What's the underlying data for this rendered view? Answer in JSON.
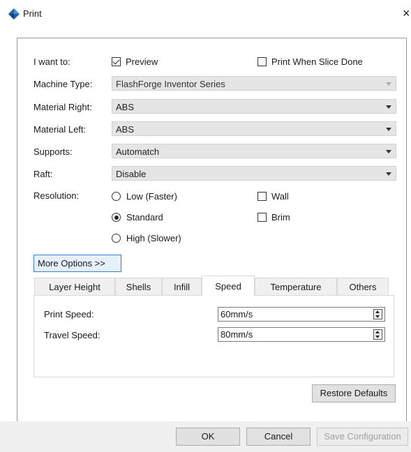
{
  "window": {
    "title": "Print",
    "close_glyph": "×"
  },
  "form": {
    "i_want_to": {
      "label": "I want to:",
      "preview": {
        "label": "Preview",
        "checked": true
      },
      "print_when_slice_done": {
        "label": "Print When Slice Done",
        "checked": false
      }
    },
    "machine_type": {
      "label": "Machine Type:",
      "value": "FlashForge Inventor Series",
      "enabled": false
    },
    "material_right": {
      "label": "Material Right:",
      "value": "ABS"
    },
    "material_left": {
      "label": "Material Left:",
      "value": "ABS"
    },
    "supports": {
      "label": "Supports:",
      "value": "Automatch"
    },
    "raft": {
      "label": "Raft:",
      "value": "Disable"
    },
    "resolution": {
      "label": "Resolution:",
      "options": [
        "Low (Faster)",
        "Standard",
        "High (Slower)"
      ],
      "selected": "Standard"
    },
    "wall": {
      "label": "Wall",
      "checked": false
    },
    "brim": {
      "label": "Brim",
      "checked": false
    }
  },
  "more_options_label": "More Options >>",
  "tabs": [
    "Layer Height",
    "Shells",
    "Infill",
    "Speed",
    "Temperature",
    "Others"
  ],
  "active_tab": "Speed",
  "speed": {
    "print_speed": {
      "label": "Print Speed:",
      "value": "60mm/s"
    },
    "travel_speed": {
      "label": "Travel Speed:",
      "value": "80mm/s"
    }
  },
  "buttons": {
    "restore_defaults": "Restore Defaults",
    "ok": "OK",
    "cancel": "Cancel",
    "save_configuration": "Save Configuration"
  },
  "colors": {
    "accent": "#3c7fd1",
    "icon_blue": "#1f5fa8",
    "combo_bg": "#e5e5e5"
  }
}
